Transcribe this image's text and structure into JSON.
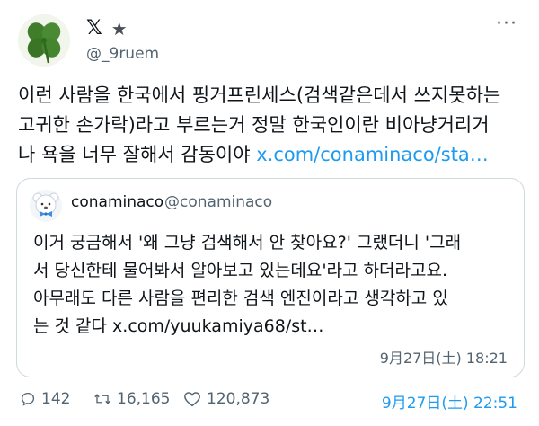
{
  "author": {
    "handle": "@_9ruem",
    "avatar_icon": "four-leaf-clover",
    "platform_logo": "𝕏",
    "star": "★",
    "more": "···"
  },
  "tweet": {
    "text_lines": [
      "이런 사람을 한국에서 핑거프린세스(검색같은데서 쓰지못하는",
      "고귀한 손가락)라고 부르는거 정말 한국인이란 비아냥거리거",
      "나 욕을 너무 잘해서 감동이야 "
    ],
    "link": "x.com/conaminaco/sta…"
  },
  "quote": {
    "name": "conaminaco",
    "handle": "@conaminaco",
    "avatar_icon": "bear-with-bowtie",
    "text_lines": [
      "이거 궁금해서 '왜 그냥 검색해서 안 찾아요?' 그랬더니 '그래",
      "서 당신한테 물어봐서 알아보고 있는데요'라고 하더라고요.",
      "아무래도 다른 사람을 편리한 검색 엔진이라고 생각하고 있",
      "는 것 같다 "
    ],
    "link": "x.com/yuukamiya68/st…",
    "timestamp": "9月27日(土) 18:21"
  },
  "footer": {
    "replies": "142",
    "retweets": "16,165",
    "likes": "120,873",
    "timestamp": "9月27日(土) 22:51"
  },
  "colors": {
    "link": "#1d9bf0",
    "muted": "#536471",
    "text": "#0f1419",
    "border": "#cfd9de"
  }
}
